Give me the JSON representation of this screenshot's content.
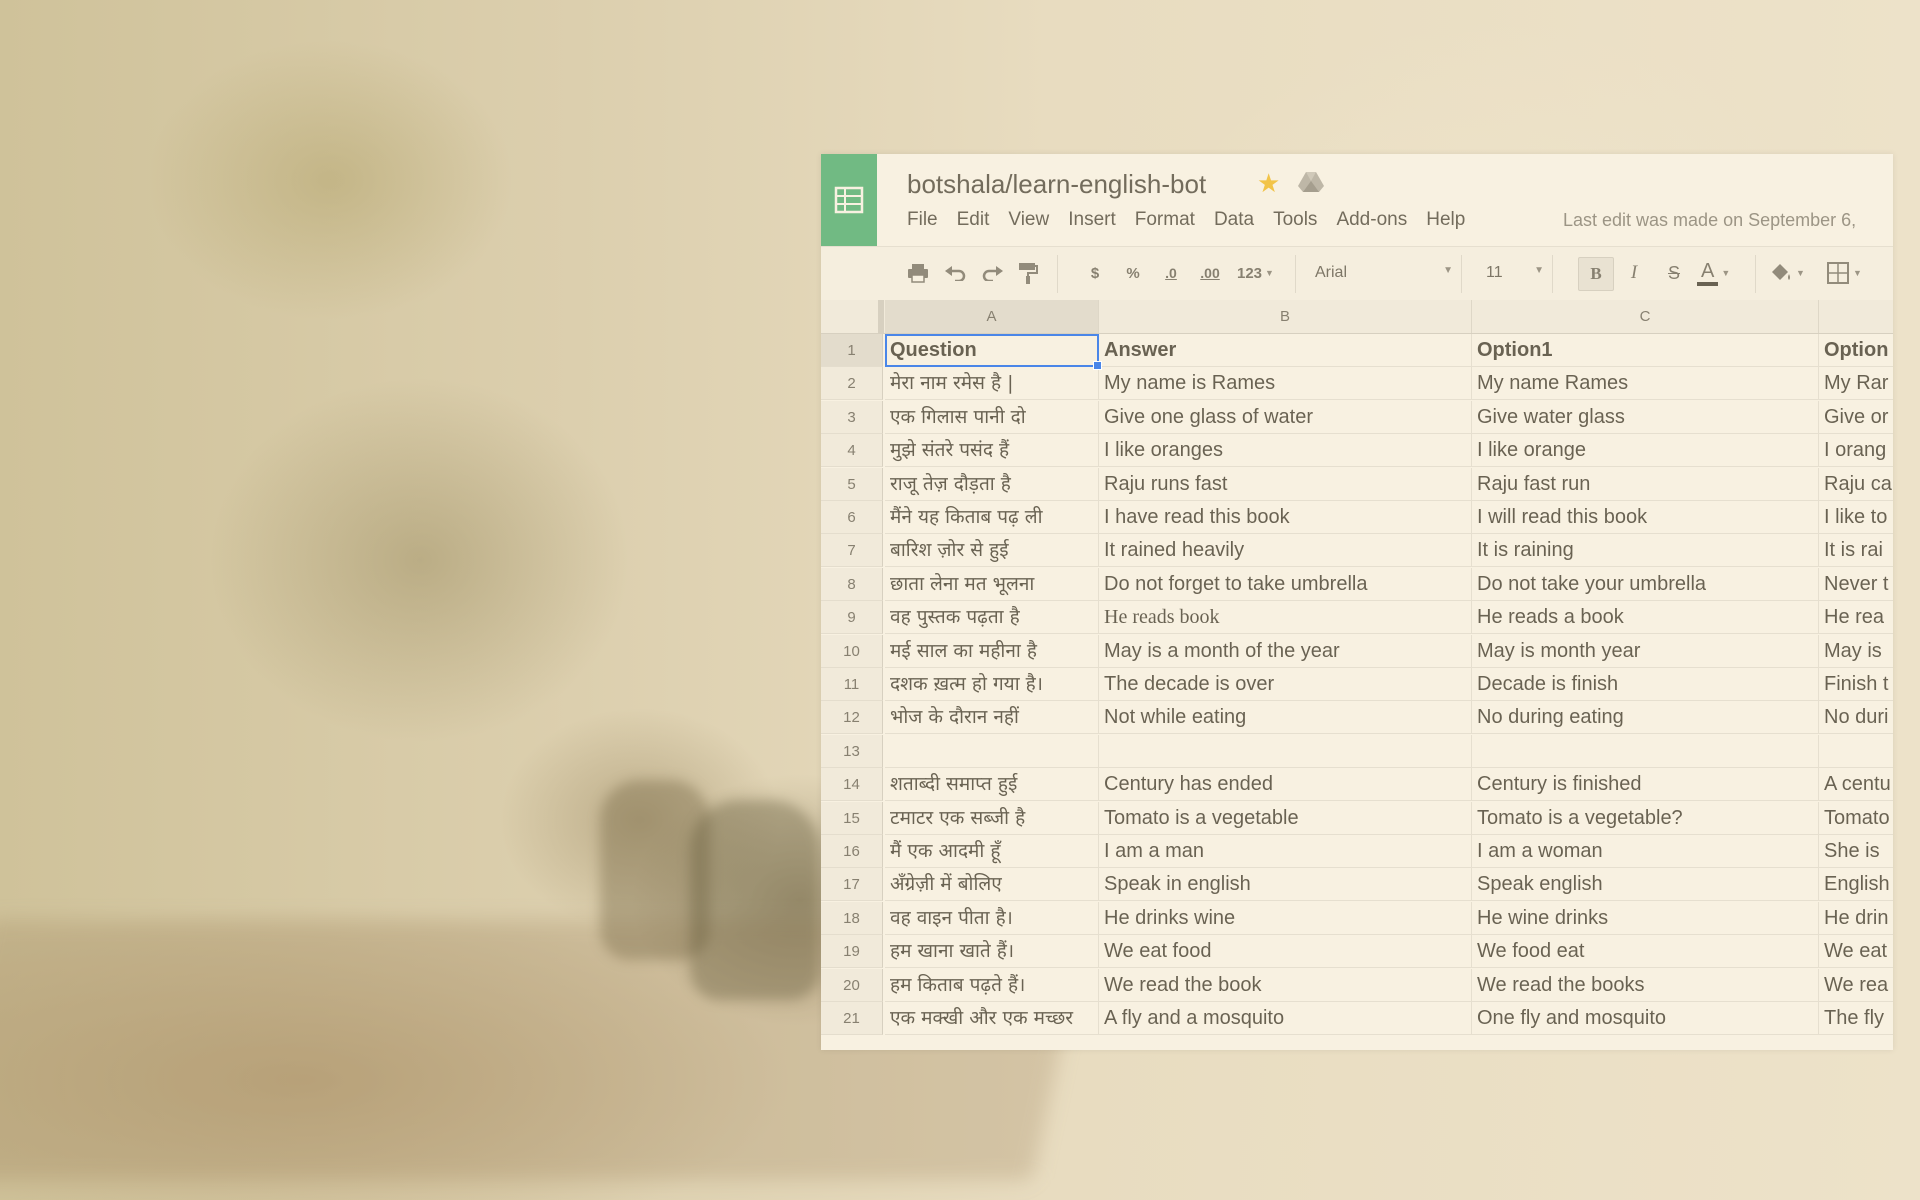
{
  "document": {
    "title": "botshala/learn-english-bot",
    "last_edit": "Last edit was made on September 6,"
  },
  "menu": [
    "File",
    "Edit",
    "View",
    "Insert",
    "Format",
    "Data",
    "Tools",
    "Add-ons",
    "Help"
  ],
  "toolbar": {
    "currency": "$",
    "percent": "%",
    "decrease_decimal": ".0",
    "increase_decimal": ".00",
    "more_formats": "123",
    "font": "Arial",
    "font_size": "11",
    "bold": "B",
    "italic": "I",
    "strikethrough": "S",
    "text_color": "A",
    "icons": [
      "print-icon",
      "undo-icon",
      "redo-icon",
      "paint-format-icon",
      "fill-color-icon",
      "borders-icon"
    ]
  },
  "columns": [
    "A",
    "B",
    "C",
    ""
  ],
  "rows": [
    {
      "n": "1",
      "cells": [
        "Question",
        "Answer",
        "Option1",
        "Option"
      ]
    },
    {
      "n": "2",
      "cells": [
        "मेरा नाम रमेस है |",
        "My name is Rames",
        "My name Rames",
        "My Rar"
      ]
    },
    {
      "n": "3",
      "cells": [
        "एक गिलास पानी दो",
        "Give one glass of water",
        "Give water glass",
        "Give or"
      ]
    },
    {
      "n": "4",
      "cells": [
        "मुझे संतरे पसंद हैं",
        "I like oranges",
        "I like orange",
        "I orang"
      ]
    },
    {
      "n": "5",
      "cells": [
        "राजू तेज़ दौड़ता है",
        "Raju runs fast",
        "Raju fast run",
        "Raju ca"
      ]
    },
    {
      "n": "6",
      "cells": [
        "मैंने यह किताब पढ़ ली",
        "I have read this book",
        "I will read this book",
        "I like to"
      ]
    },
    {
      "n": "7",
      "cells": [
        "बारिश ज़ोर से हुई",
        "It rained heavily",
        "It is raining",
        "It is rai"
      ]
    },
    {
      "n": "8",
      "cells": [
        "छाता लेना मत भूलना",
        "Do not forget to take umbrella",
        "Do not take your umbrella",
        "Never t"
      ]
    },
    {
      "n": "9",
      "cells": [
        "वह पुस्तक पढ़ता है",
        "He reads book",
        "He reads a book",
        "He rea"
      ]
    },
    {
      "n": "10",
      "cells": [
        "मई  साल का महीना है",
        "May is a month of the year",
        "May is month year",
        "May is"
      ]
    },
    {
      "n": "11",
      "cells": [
        "दशक ख़त्म हो गया है।",
        "The decade is over",
        "Decade is finish",
        "Finish t"
      ]
    },
    {
      "n": "12",
      "cells": [
        "भोज के दौरान नहीं",
        "Not while eating",
        "No during eating",
        "No duri"
      ]
    },
    {
      "n": "13",
      "cells": [
        "",
        "",
        "",
        ""
      ]
    },
    {
      "n": "14",
      "cells": [
        "शताब्दी समाप्त हुई",
        "Century has ended",
        "Century is finished",
        "A centu"
      ]
    },
    {
      "n": "15",
      "cells": [
        "टमाटर एक सब्जी है",
        "Tomato is a vegetable",
        "Tomato is a vegetable?",
        "Tomato"
      ]
    },
    {
      "n": "16",
      "cells": [
        "मैं एक आदमी हूँ",
        "I am a man",
        "I am a woman",
        "She is"
      ]
    },
    {
      "n": "17",
      "cells": [
        "अँग्रेज़ी में बोलिए",
        "Speak in english",
        "Speak english",
        "English"
      ]
    },
    {
      "n": "18",
      "cells": [
        "वह वाइन पीता है।",
        "He drinks wine",
        "He wine drinks",
        "He drin"
      ]
    },
    {
      "n": "19",
      "cells": [
        "हम खाना खाते हैं।",
        "We eat food",
        "We food eat",
        "We eat"
      ]
    },
    {
      "n": "20",
      "cells": [
        "हम किताब पढ़ते हैं।",
        "We read the book",
        "We read the books",
        "We rea"
      ]
    },
    {
      "n": "21",
      "cells": [
        "एक मक्खी और एक मच्छर",
        "A fly and a mosquito",
        "One fly and mosquito",
        "The fly"
      ]
    }
  ],
  "colors": {
    "brand_green": "#1fa463",
    "star": "#f5b400",
    "selection": "#4a86e8"
  }
}
